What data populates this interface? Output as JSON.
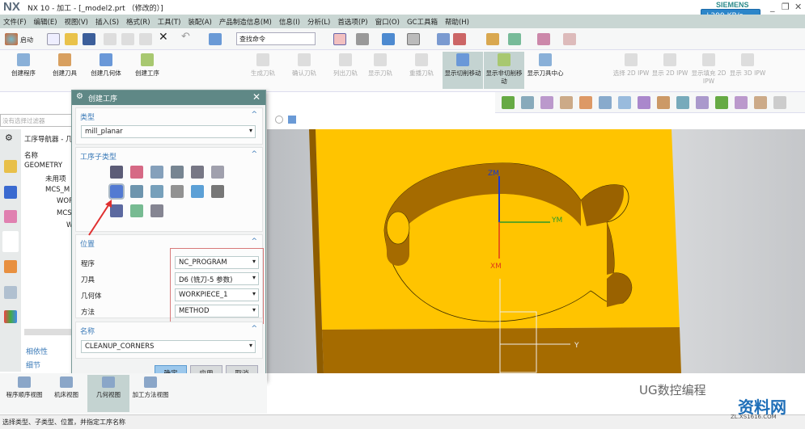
{
  "window": {
    "logo": "NX",
    "title": "NX 10 - 加工 - [_model2.prt （修改的）]",
    "brand": "SIEMENS",
    "speed": "↓299 KB/s"
  },
  "menu": [
    "文件(F)",
    "编辑(E)",
    "视图(V)",
    "插入(S)",
    "格式(R)",
    "工具(T)",
    "装配(A)",
    "产品制造信息(M)",
    "信息(I)",
    "分析(L)",
    "首选项(P)",
    "窗口(O)",
    "GC工具箱",
    "帮助(H)"
  ],
  "toolbar": {
    "start": "启动",
    "search_placeholder": "查找命令"
  },
  "ribbon": {
    "groups": [
      [
        {
          "label": "创建程序",
          "enabled": true
        },
        {
          "label": "创建刀具",
          "enabled": true
        },
        {
          "label": "创建几何体",
          "enabled": true
        },
        {
          "label": "创建工序",
          "enabled": true
        }
      ],
      [
        {
          "label": "生成刀轨",
          "enabled": false
        },
        {
          "label": "确认刀轨",
          "enabled": false
        },
        {
          "label": "列出刀轨",
          "enabled": false
        }
      ],
      [
        {
          "label": "显示刀轨",
          "enabled": false
        },
        {
          "label": "重播刀轨",
          "enabled": false
        },
        {
          "label": "显示切削移动",
          "enabled": true,
          "active": true
        },
        {
          "label": "显示非切削移动",
          "enabled": true,
          "active": true
        },
        {
          "label": "显示刀具中心",
          "enabled": true
        }
      ],
      [
        {
          "label": "选择 2D IPW",
          "enabled": false
        },
        {
          "label": "显示 2D IPW",
          "enabled": false
        },
        {
          "label": "显示填充 2D IPW",
          "enabled": false
        },
        {
          "label": "显示 3D IPW",
          "enabled": false
        }
      ]
    ]
  },
  "filter": {
    "placeholder": "没有选择过滤器"
  },
  "navigator": {
    "title": "工序导航器 - 几",
    "column": "名称",
    "items": [
      "GEOMETRY",
      "未用项",
      "MCS_M",
      "WOR",
      "MCS",
      "W"
    ],
    "dependencies": "相依性",
    "details": "细节"
  },
  "dialog": {
    "title": "创建工序",
    "type_section": "类型",
    "type_value": "mill_planar",
    "subtype_section": "工序子类型",
    "location_section": "位置",
    "fields": [
      {
        "label": "程序",
        "value": "NC_PROGRAM"
      },
      {
        "label": "刀具",
        "value": "D6 (铣刀-5 参数)"
      },
      {
        "label": "几何体",
        "value": "WORKPIECE_1"
      },
      {
        "label": "方法",
        "value": "METHOD"
      }
    ],
    "name_section": "名称",
    "name_value": "CLEANUP_CORNERS",
    "ok": "确定",
    "apply": "应用",
    "cancel": "取消"
  },
  "views": [
    "程序顺序视图",
    "机床视图",
    "几何视图",
    "加工方法视图"
  ],
  "viewport": {
    "axes": [
      "ZM",
      "YM",
      "XM",
      "Y"
    ],
    "colors": {
      "top": "#ffc400",
      "side": "#a56b00"
    }
  },
  "status": "选择类型、子类型、位置，并指定工序名称",
  "watermark": {
    "text": "UG数控编程",
    "site": "资料网",
    "url": "ZL.XS1616.COM"
  }
}
